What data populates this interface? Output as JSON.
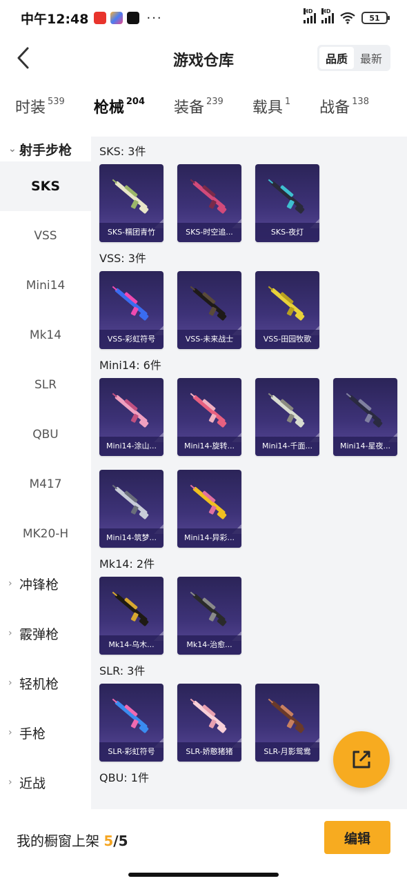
{
  "status_bar": {
    "time": "中午12:48",
    "more": "···",
    "hd1": "HD",
    "hd2": "HD",
    "battery": "51",
    "app_colors": [
      "#e8342c",
      "#4a7cf2",
      "#111111"
    ]
  },
  "header": {
    "title": "游戏仓库",
    "sort_options": [
      "品质",
      "最新"
    ],
    "active_sort": "品质"
  },
  "tabs": [
    {
      "label": "时装",
      "count": "539"
    },
    {
      "label": "枪械",
      "count": "204"
    },
    {
      "label": "装备",
      "count": "239"
    },
    {
      "label": "载具",
      "count": "1"
    },
    {
      "label": "战备",
      "count": "138"
    }
  ],
  "active_tab": "枪械",
  "sidebar": {
    "open_group": "射手步枪",
    "items": [
      "SKS",
      "VSS",
      "Mini14",
      "Mk14",
      "SLR",
      "QBU",
      "M417",
      "MK20-H"
    ],
    "active_item": "SKS",
    "collapsed_groups": [
      "冲锋枪",
      "霰弹枪",
      "轻机枪",
      "手枪",
      "近战"
    ]
  },
  "sections": [
    {
      "title": "SKS: 3件",
      "items": [
        {
          "name": "SKS-糯团青竹",
          "colors": [
            "#e8e6c8",
            "#9bb56a"
          ]
        },
        {
          "name": "SKS-时空追...",
          "colors": [
            "#d24a7a",
            "#7a2a4a"
          ]
        },
        {
          "name": "SKS-夜灯",
          "colors": [
            "#2a2a3a",
            "#3ec0d0"
          ]
        }
      ]
    },
    {
      "title": "VSS: 3件",
      "items": [
        {
          "name": "VSS-彩虹符号",
          "colors": [
            "#3a6cf0",
            "#f04ab0"
          ]
        },
        {
          "name": "VSS-未来战士",
          "colors": [
            "#1e1a18",
            "#5a4a3a"
          ]
        },
        {
          "name": "VSS-田园牧歌",
          "colors": [
            "#e8d23a",
            "#b8a020"
          ]
        }
      ]
    },
    {
      "title": "Mini14: 6件",
      "items": [
        {
          "name": "Mini14-涂山...",
          "colors": [
            "#f0a0c0",
            "#c05080"
          ]
        },
        {
          "name": "Mini14-旋转...",
          "colors": [
            "#e86080",
            "#f0b0c0"
          ]
        },
        {
          "name": "Mini14-千面...",
          "colors": [
            "#d8dcd0",
            "#8a8a80"
          ]
        },
        {
          "name": "Mini14-星夜...",
          "colors": [
            "#2a2a40",
            "#8080a0"
          ]
        },
        {
          "name": "Mini14-筑梦...",
          "colors": [
            "#c8ccd8",
            "#6a6e7a"
          ]
        },
        {
          "name": "Mini14-异彩...",
          "colors": [
            "#f0c020",
            "#e070a0"
          ]
        }
      ]
    },
    {
      "title": "Mk14: 2件",
      "items": [
        {
          "name": "Mk14-乌木...",
          "colors": [
            "#1e1a14",
            "#d8a830"
          ]
        },
        {
          "name": "Mk14-治愈...",
          "colors": [
            "#2a2a2a",
            "#8a8a8a"
          ]
        }
      ]
    },
    {
      "title": "SLR: 3件",
      "items": [
        {
          "name": "SLR-彩虹符号",
          "colors": [
            "#3a8cf0",
            "#f06ab0"
          ]
        },
        {
          "name": "SLR-娇憨猪猪",
          "colors": [
            "#f8d0d8",
            "#e8a0b0"
          ]
        },
        {
          "name": "SLR-月影鸳鸯",
          "colors": [
            "#6a3a2a",
            "#c88060"
          ]
        }
      ]
    },
    {
      "title": "QBU: 1件",
      "items": []
    }
  ],
  "bottom": {
    "shelf_label": "我的橱窗上架",
    "shelf_count": "5",
    "shelf_total": "/5",
    "edit_label": "编辑"
  },
  "accent": "#f7ab20"
}
